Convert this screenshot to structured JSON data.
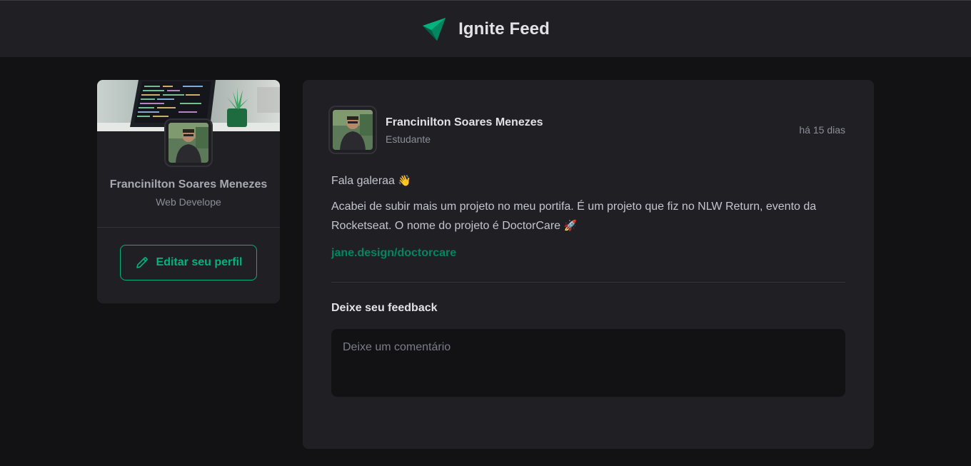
{
  "header": {
    "title": "Ignite Feed",
    "logo_icon": "paper-plane-icon",
    "accent": "#00b37e"
  },
  "sidebar": {
    "avatar_icon": "avatar",
    "name": "Francinilton Soares Menezes",
    "role": "Web Develope",
    "edit_button_label": "Editar seu perfil",
    "edit_icon": "pencil-icon"
  },
  "post": {
    "author_name": "Francinilton Soares Menezes",
    "author_role": "Estudante",
    "time": "há 15 dias",
    "greeting": "Fala galeraa",
    "greeting_emoji": "👋",
    "body": "Acabei de subir mais um projeto no meu portifa. É um projeto que fiz no NLW Return, evento da Rocketseat. O nome do projeto é DoctorCare",
    "body_emoji": "🚀",
    "link": "jane.design/doctorcare",
    "feedback_title": "Deixe seu feedback",
    "comment_placeholder": "Deixe um comentário"
  }
}
